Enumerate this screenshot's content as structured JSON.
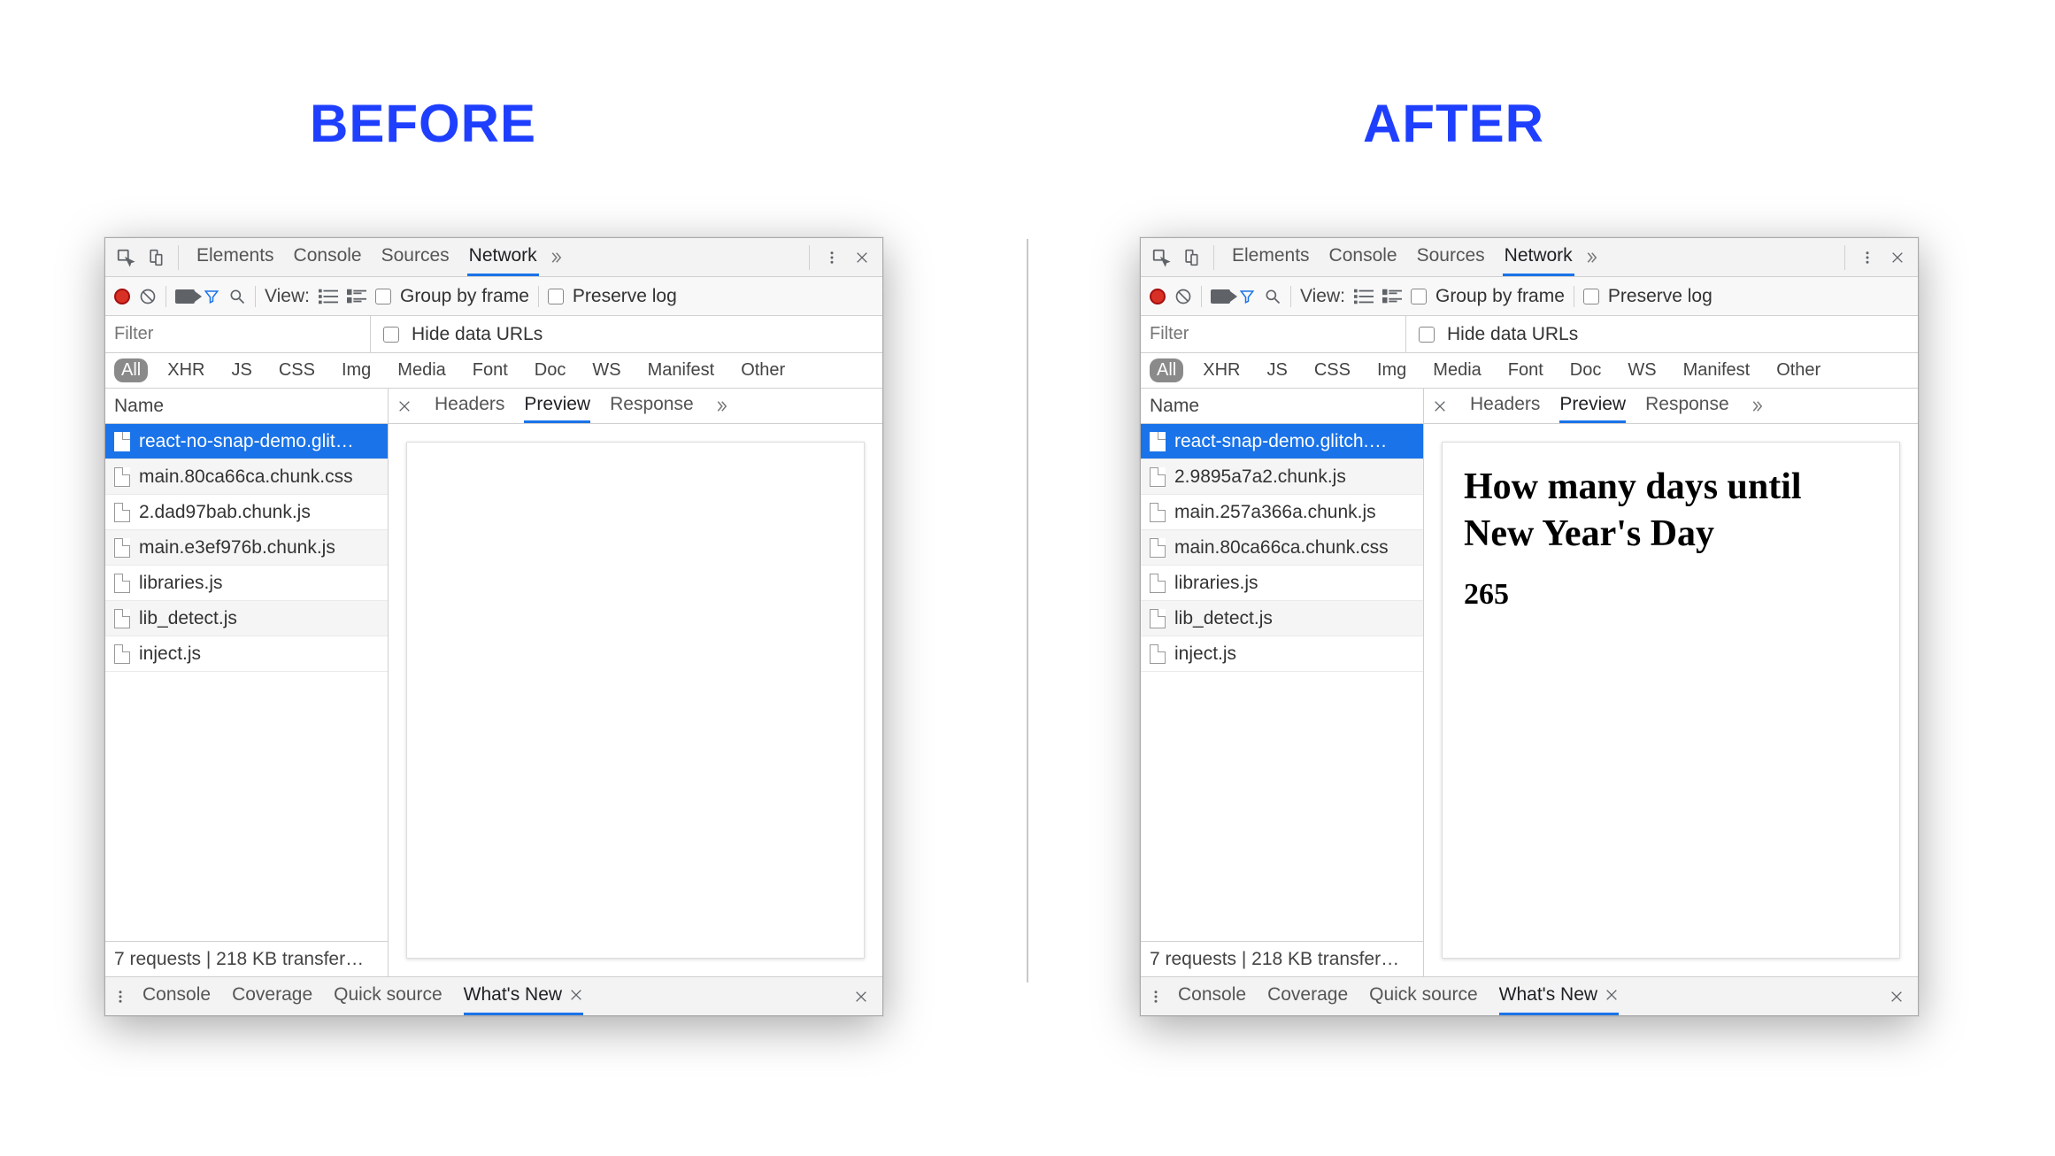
{
  "headings": {
    "before": "BEFORE",
    "after": "AFTER"
  },
  "main_tabs": {
    "items": [
      "Elements",
      "Console",
      "Sources",
      "Network"
    ],
    "active_index": 3
  },
  "net_toolbar": {
    "view_label": "View:",
    "group_by_frame": "Group by frame",
    "preserve_log": "Preserve log"
  },
  "filter": {
    "placeholder": "Filter",
    "hide_data_urls": "Hide data URLs"
  },
  "type_filters": {
    "items": [
      "All",
      "XHR",
      "JS",
      "CSS",
      "Img",
      "Media",
      "Font",
      "Doc",
      "WS",
      "Manifest",
      "Other"
    ],
    "active_index": 0
  },
  "requests_header": "Name",
  "detail_tabs": {
    "items": [
      "Headers",
      "Preview",
      "Response"
    ],
    "active_index": 1
  },
  "drawer": {
    "items": [
      "Console",
      "Coverage",
      "Quick source",
      "What's New"
    ],
    "active_index": 3
  },
  "status_bar": "7 requests | 218 KB transfer…",
  "before": {
    "requests": [
      {
        "name": "react-no-snap-demo.glit…",
        "selected": true
      },
      {
        "name": "main.80ca66ca.chunk.css"
      },
      {
        "name": "2.dad97bab.chunk.js"
      },
      {
        "name": "main.e3ef976b.chunk.js"
      },
      {
        "name": "libraries.js"
      },
      {
        "name": "lib_detect.js"
      },
      {
        "name": "inject.js"
      }
    ],
    "preview_html": {
      "heading": "",
      "count": ""
    }
  },
  "after": {
    "requests": [
      {
        "name": "react-snap-demo.glitch.…",
        "selected": true
      },
      {
        "name": "2.9895a7a2.chunk.js"
      },
      {
        "name": "main.257a366a.chunk.js"
      },
      {
        "name": "main.80ca66ca.chunk.css"
      },
      {
        "name": "libraries.js"
      },
      {
        "name": "lib_detect.js"
      },
      {
        "name": "inject.js"
      }
    ],
    "preview_html": {
      "heading": "How many days until New Year's Day",
      "count": "265"
    }
  }
}
